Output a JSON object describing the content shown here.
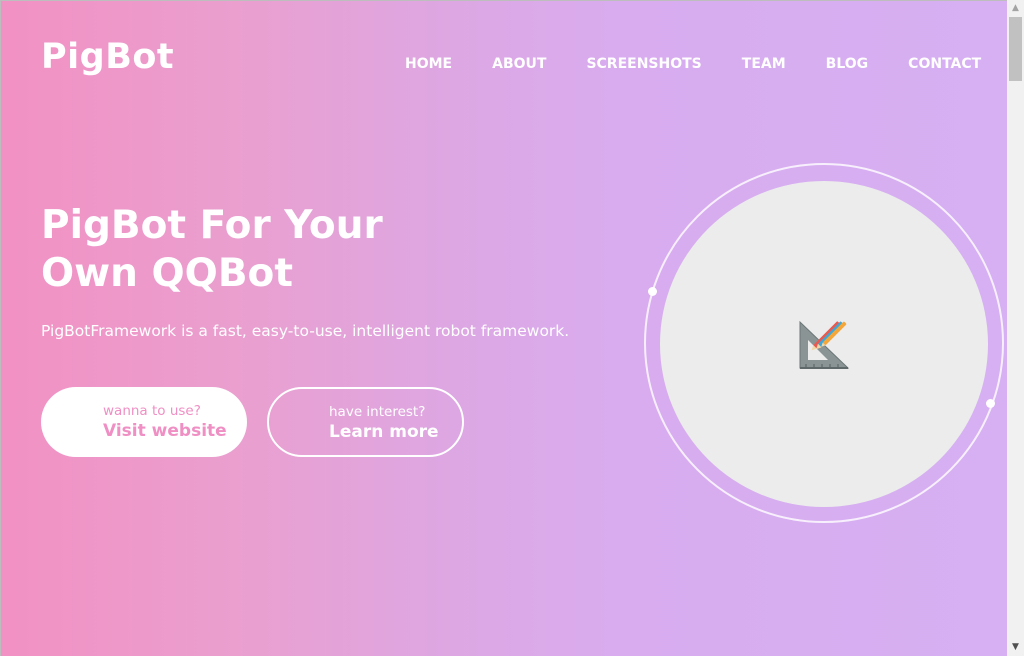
{
  "brand": {
    "logo": "PigBot"
  },
  "nav": {
    "items": [
      "HOME",
      "ABOUT",
      "SCREENSHOTS",
      "TEAM",
      "BLOG",
      "CONTACT"
    ]
  },
  "hero": {
    "headline_line1": "PigBot For Your",
    "headline_line2": "Own QQBot",
    "subline": "PigBotFramework is a fast, easy-to-use, intelligent robot framework.",
    "primary_button": {
      "small": "wanna to use?",
      "big": "Visit website"
    },
    "secondary_button": {
      "small": "have interest?",
      "big": "Learn more"
    },
    "image_icon": "broken-image-icon"
  },
  "scrollbar": {
    "up": "▲",
    "down": "▼"
  },
  "colors": {
    "gradient_start": "#f291c3",
    "gradient_end": "#d6b0f2",
    "accent_pink": "#ef8fc4",
    "circle_bg": "#ececec"
  }
}
